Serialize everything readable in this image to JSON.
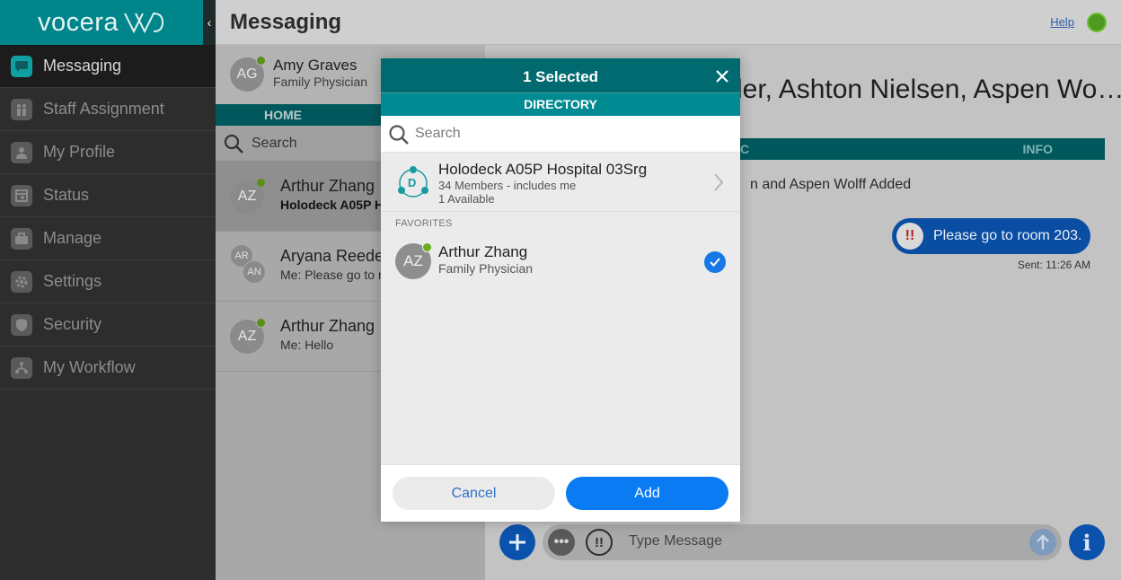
{
  "app": {
    "brand": "vocera",
    "page_title": "Messaging",
    "help_label": "Help"
  },
  "colors": {
    "brand_teal": "#00858a",
    "dark_teal": "#006a70",
    "primary_blue": "#0a7bf2",
    "online_green": "#5a8f18",
    "urgent_red": "#b01e1e"
  },
  "sidebar": {
    "items": [
      {
        "label": "Messaging",
        "icon": "chat-bubble-icon",
        "active": true
      },
      {
        "label": "Staff Assignment",
        "icon": "staff-icon",
        "active": false
      },
      {
        "label": "My Profile",
        "icon": "person-icon",
        "active": false
      },
      {
        "label": "Status",
        "icon": "status-icon",
        "active": false
      },
      {
        "label": "Manage",
        "icon": "briefcase-icon",
        "active": false
      },
      {
        "label": "Settings",
        "icon": "gear-icon",
        "active": false
      },
      {
        "label": "Security",
        "icon": "shield-icon",
        "active": false
      },
      {
        "label": "My Workflow",
        "icon": "workflow-icon",
        "active": false
      }
    ]
  },
  "me": {
    "initials": "AG",
    "name": "Amy Graves",
    "role": "Family Physician"
  },
  "list": {
    "home_tab": "HOME",
    "search_placeholder": "Search",
    "conversations": [
      {
        "initials": "AZ",
        "name": "Arthur Zhang",
        "sub": "Holodeck A05P Ho"
      },
      {
        "initials_a": "AR",
        "initials_b": "AN",
        "name": "Aryana Reede",
        "sub": "Me: Please go to r"
      },
      {
        "initials": "AZ",
        "name": "Arthur Zhang",
        "sub": "Me: Hello"
      }
    ]
  },
  "chat": {
    "title": "ler, Ashton Nielsen, Aspen Wo…",
    "tab_left": "C",
    "tab_info": "INFO",
    "system_message": "n and Aspen Wolff Added",
    "urgent_mark": "!!",
    "message_text": "Please go to room 203.",
    "sent_time": "Sent: 11:26 AM",
    "compose_placeholder": "Type Message",
    "more_label": "•••",
    "info_label": "i"
  },
  "modal": {
    "title": "1 Selected",
    "tab": "DIRECTORY",
    "search_placeholder": "Search",
    "directory": {
      "badge": "D",
      "name": "Holodeck A05P Hospital 03Srg",
      "members": "34 Members - includes me",
      "available": "1 Available"
    },
    "favorites_label": "FAVORITES",
    "favorite": {
      "initials": "AZ",
      "name": "Arthur Zhang",
      "role": "Family Physician",
      "selected": true
    },
    "cancel_label": "Cancel",
    "add_label": "Add"
  }
}
